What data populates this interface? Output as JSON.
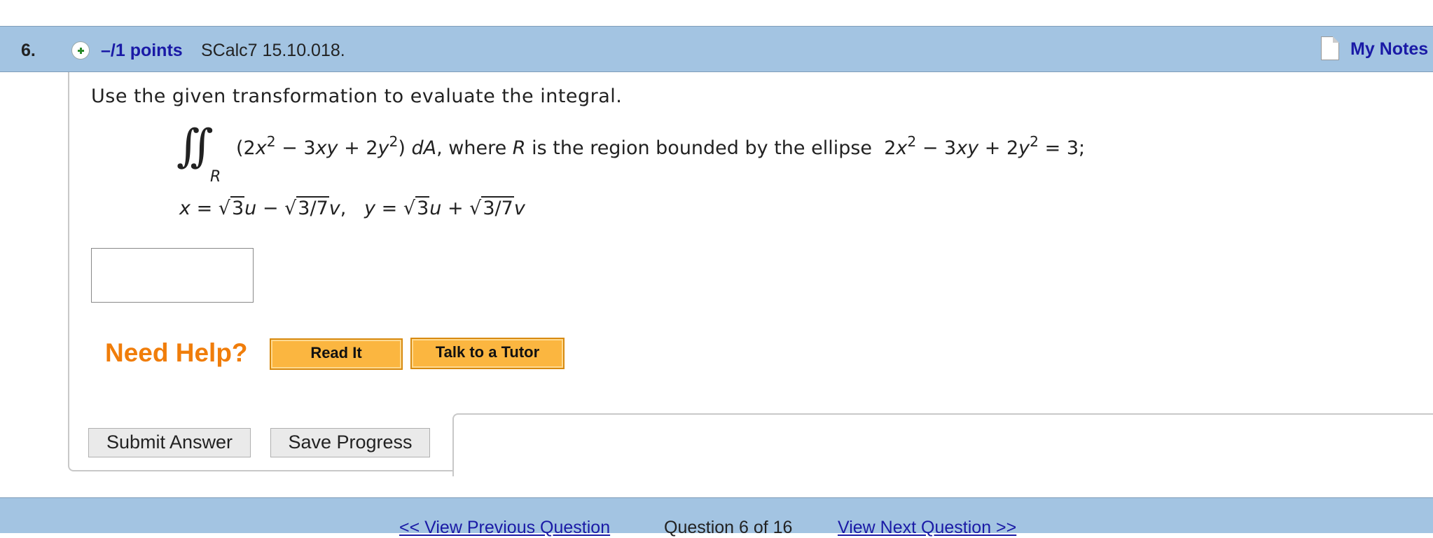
{
  "header": {
    "question_number": "6.",
    "points": "–/1 points",
    "reference": "SCalc7 15.10.018.",
    "my_notes": "My Notes"
  },
  "question": {
    "prompt": "Use the given transformation to evaluate the integral.",
    "region_label": "R"
  },
  "help": {
    "label": "Need Help?",
    "read_it": "Read It",
    "tutor": "Talk to a Tutor"
  },
  "actions": {
    "submit": "Submit Answer",
    "save": "Save Progress"
  },
  "footer": {
    "prev": "<< View Previous Question",
    "count": "Question 6 of 16",
    "next": "View Next Question >>"
  },
  "colors": {
    "header_bg": "#a3c4e2",
    "link": "#1a1aa6",
    "help_orange": "#f07d0a",
    "button_orange": "#fbb640"
  }
}
